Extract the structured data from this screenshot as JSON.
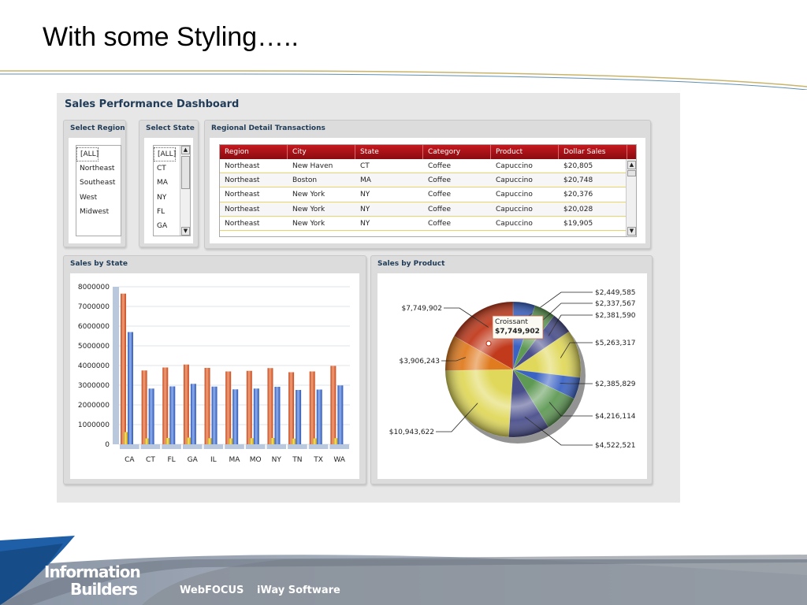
{
  "slide": {
    "title": "With some Styling…..",
    "brand_line1": "Information",
    "brand_line2": "Builders",
    "products": [
      "WebFOCUS",
      "iWay Software"
    ]
  },
  "dashboard": {
    "title": "Sales Performance Dashboard",
    "region_panel": {
      "title": "Select Region",
      "options": [
        "[ALL]",
        "Northeast",
        "Southeast",
        "West",
        "Midwest"
      ],
      "selected": "[ALL]"
    },
    "state_panel": {
      "title": "Select State",
      "options": [
        "[ALL]",
        "CT",
        "MA",
        "NY",
        "FL",
        "GA"
      ],
      "selected": "[ALL]"
    },
    "transactions_panel": {
      "title": "Regional Detail Transactions",
      "columns": [
        "Region",
        "City",
        "State",
        "Category",
        "Product",
        "Dollar Sales"
      ],
      "rows": [
        [
          "Northeast",
          "New Haven",
          "CT",
          "Coffee",
          "Capuccino",
          "$20,805"
        ],
        [
          "Northeast",
          "Boston",
          "MA",
          "Coffee",
          "Capuccino",
          "$20,748"
        ],
        [
          "Northeast",
          "New York",
          "NY",
          "Coffee",
          "Capuccino",
          "$20,376"
        ],
        [
          "Northeast",
          "New York",
          "NY",
          "Coffee",
          "Capuccino",
          "$20,028"
        ],
        [
          "Northeast",
          "New York",
          "NY",
          "Coffee",
          "Capuccino",
          "$19,905"
        ]
      ]
    },
    "sales_by_state_title": "Sales by State",
    "sales_by_product_title": "Sales by Product",
    "tooltip": {
      "label": "Croissant",
      "value": "$7,749,902"
    }
  },
  "colors": {
    "header_red": "#b3151b",
    "series_orange": "#d9643a",
    "series_blue": "#4a73c9",
    "series_yellow": "#d9b81c",
    "title_navy": "#1f3b57"
  },
  "chart_data": [
    {
      "type": "bar",
      "title": "Sales by State",
      "categories": [
        "CA",
        "CT",
        "FL",
        "GA",
        "IL",
        "MA",
        "MO",
        "NY",
        "TN",
        "TX",
        "WA"
      ],
      "series": [
        {
          "values": [
            7650000,
            3750000,
            3900000,
            4050000,
            3880000,
            3700000,
            3730000,
            3870000,
            3660000,
            3700000,
            3980000
          ]
        },
        {
          "values": [
            5700000,
            2830000,
            2940000,
            3070000,
            2930000,
            2790000,
            2830000,
            2920000,
            2760000,
            2780000,
            2990000
          ]
        },
        {
          "values": [
            620000,
            300000,
            320000,
            340000,
            310000,
            300000,
            310000,
            320000,
            290000,
            300000,
            310000
          ]
        }
      ],
      "ylim": [
        0,
        8000000
      ],
      "yticks": [
        "8000000",
        "7000000",
        "6000000",
        "5000000",
        "4000000",
        "3000000",
        "2000000",
        "1000000",
        "0"
      ],
      "grid": true
    },
    {
      "type": "pie",
      "title": "Sales by Product",
      "slices": [
        {
          "label": "$2,449,585",
          "value": 2449585,
          "color": "#3b63c4"
        },
        {
          "label": "$2,337,567",
          "value": 2337567,
          "color": "#5f9a55"
        },
        {
          "label": "$2,381,590",
          "value": 2381590,
          "color": "#4a4f8c"
        },
        {
          "label": "$5,263,317",
          "value": 5263317,
          "color": "#e0d85a"
        },
        {
          "label": "$2,385,829",
          "value": 2385829,
          "color": "#3b63c4"
        },
        {
          "label": "$4,216,114",
          "value": 4216114,
          "color": "#5f9a55"
        },
        {
          "label": "$4,522,521",
          "value": 4522521,
          "color": "#4a4f8c"
        },
        {
          "label": "$10,943,622",
          "value": 10943622,
          "color": "#e0d85a"
        },
        {
          "label": "$3,906,243",
          "value": 3906243,
          "color": "#e07b1f"
        },
        {
          "label": "$7,749,902",
          "value": 7749902,
          "color": "#c13a1c"
        }
      ]
    }
  ]
}
